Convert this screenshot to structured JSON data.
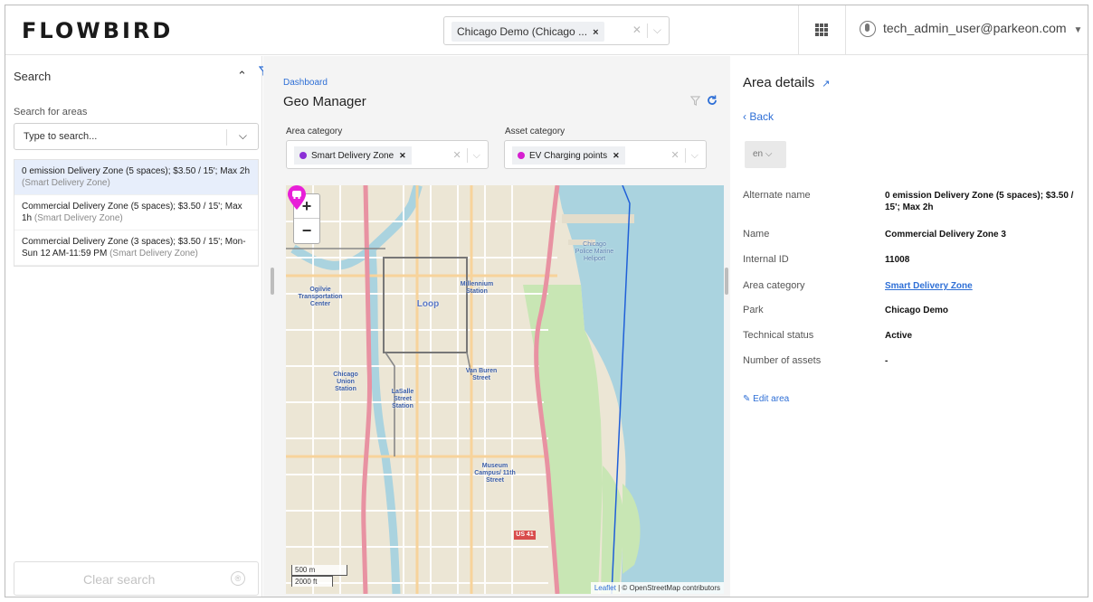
{
  "header": {
    "logo": "FLOWBIRD",
    "park_selector": {
      "value": "Chicago Demo (Chicago ...",
      "remove": "×",
      "clear": "✕",
      "open": "⌵"
    },
    "apps_icon": "grid-icon",
    "user": {
      "email": "tech_admin_user@parkeon.com",
      "caret": "▼"
    }
  },
  "left_panel": {
    "title": "Search",
    "collapse": "⌃",
    "search_label": "Search for areas",
    "search_placeholder": "Type to search...",
    "dropdown": "⌵",
    "results": [
      {
        "name": "0 emission Delivery Zone (5 spaces); $3.50 / 15'; Max 2h",
        "category": "(Smart Delivery Zone)",
        "active": true
      },
      {
        "name": "Commercial Delivery Zone (5 spaces); $3.50 / 15'; Max 1h",
        "category": "(Smart Delivery Zone)",
        "active": false
      },
      {
        "name": "Commercial Delivery Zone (3 spaces); $3.50 / 15'; Mon-Sun 12 AM-11:59 PM",
        "category": "(Smart Delivery Zone)",
        "active": false
      }
    ],
    "clear_button": "Clear search",
    "clear_icon": "®"
  },
  "center": {
    "breadcrumb": "Dashboard",
    "title": "Geo Manager",
    "area_category": {
      "label": "Area category",
      "value": "Smart Delivery Zone",
      "color": "#8b2fd6"
    },
    "asset_category": {
      "label": "Asset category",
      "value": "EV Charging points",
      "color": "#d61fd0"
    },
    "map": {
      "zoom_in": "+",
      "zoom_out": "−",
      "scale_m": "500 m",
      "scale_ft": "2000 ft",
      "attribution_link": "Leaflet",
      "attribution_text": " | © OpenStreetMap contributors",
      "labels": {
        "millennium": "Millennium Station",
        "ogilvie": "Ogilvie Transportation Center",
        "loop": "Loop",
        "union": "Chicago Union Station",
        "vanburen": "Van Buren Street",
        "lasalle": "LaSalle Street Station",
        "museum": "Museum Campus/ 11th Street",
        "policemarine": "Chicago Police Marine Heliport",
        "us41": "US 41"
      }
    }
  },
  "right_panel": {
    "title": "Area details",
    "back": "Back",
    "language": "en ⌵",
    "details": [
      {
        "key": "Alternate name",
        "value": "0 emission Delivery Zone (5 spaces); $3.50 / 15'; Max 2h"
      },
      {
        "key": "Name",
        "value": "Commercial Delivery Zone 3"
      },
      {
        "key": "Internal ID",
        "value": "11008"
      },
      {
        "key": "Area category",
        "value": "Smart Delivery Zone"
      },
      {
        "key": "Park",
        "value": "Chicago Demo"
      },
      {
        "key": "Technical status",
        "value": "Active"
      },
      {
        "key": "Number of assets",
        "value": "-"
      }
    ],
    "edit": "Edit area"
  }
}
